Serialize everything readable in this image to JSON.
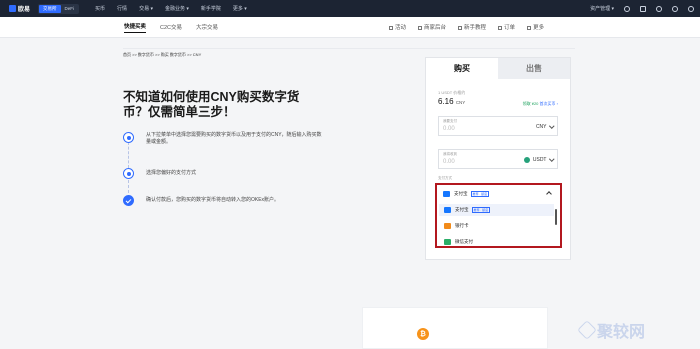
{
  "topbar": {
    "logo_text": "欧易",
    "segments": [
      "交易所",
      "DeFi"
    ],
    "nav": [
      "买币",
      "行情",
      "交易 ▾",
      "金融业务 ▾",
      "新手学院",
      "更多 ▾"
    ],
    "right_label": "资产管理 ▾",
    "right_icons": [
      "user-icon",
      "download-icon",
      "bell-icon",
      "help-icon",
      "globe-icon"
    ]
  },
  "subbar": {
    "tabs": [
      "快捷买卖",
      "C2C交易",
      "大宗交易"
    ],
    "links": [
      "活动",
      "商家后台",
      "新手教程",
      "订单",
      "更多"
    ]
  },
  "breadcrumb": "首页 >> 数字货币 >> 购买 数字货币 >> CNY",
  "hero": {
    "title": "不知道如何使用CNY购买数字货币？仅需简单三步！",
    "steps": [
      "从下拉菜单中选择您需要购买的数字货币以及用于支付的CNY，随后输入购买数量或金额。",
      "选择您偏好的支付方式",
      "确认付款后，您购买的数字货币将自动转入您的OKEx账户。"
    ]
  },
  "trade_panel": {
    "tab_buy": "购买",
    "tab_sell": "出售",
    "rate_label": "1 USDT 价格约",
    "rate_value": "6.16",
    "rate_unit": "CNY",
    "promo_text": "领取 ¥20",
    "promo_link": "首次买币 ›",
    "pay_field_label": "我要支付",
    "pay_field_placeholder": "0.00",
    "pay_currency": "CNY",
    "receive_field_label": "我将收到",
    "receive_field_placeholder": "0.00",
    "receive_currency": "USDT",
    "payment_label": "支付方式"
  },
  "payment_dropdown": {
    "selected": "支付宝",
    "selected_badge": "推荐 · 额度",
    "options": [
      {
        "label": "支付宝",
        "badge": "推荐 · 额度",
        "color": "#1677ff"
      },
      {
        "label": "银行卡",
        "badge": "",
        "color": "#f28b1a"
      },
      {
        "label": "微信支付",
        "badge": "",
        "color": "#2aae67"
      }
    ]
  },
  "watermark": "聚较网",
  "colors": {
    "accent": "#2f6bff",
    "highlight_border": "#b3181f",
    "topbar": "#1c2433"
  }
}
